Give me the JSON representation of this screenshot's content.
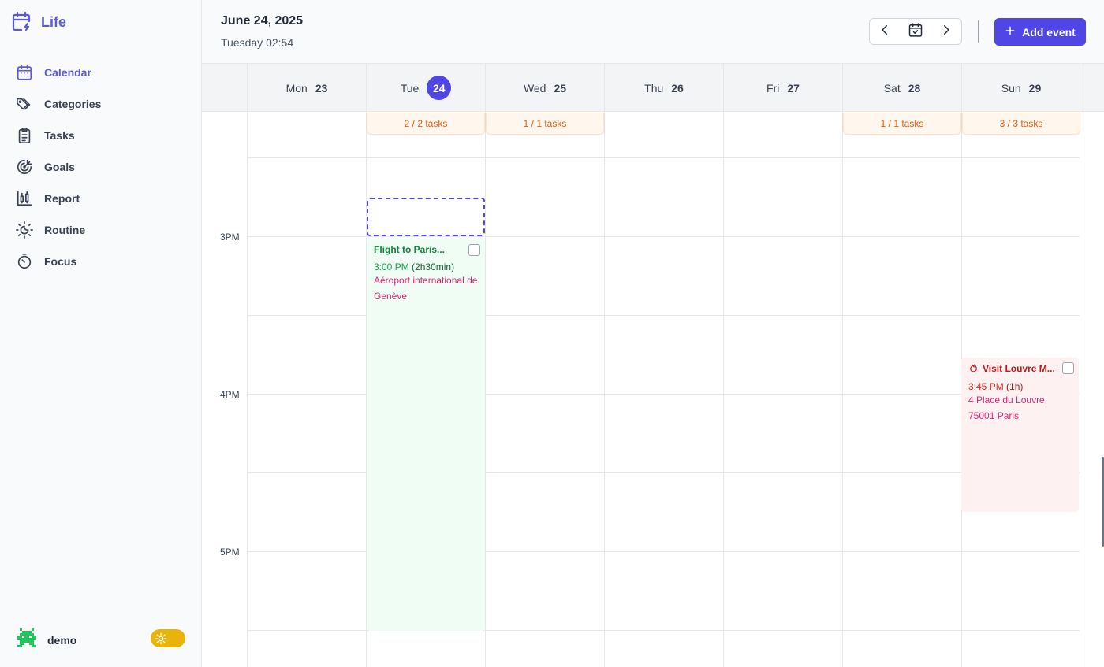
{
  "app": {
    "name": "Life"
  },
  "sidebar": {
    "items": [
      {
        "label": "Calendar",
        "icon": "calendar-icon",
        "active": true
      },
      {
        "label": "Categories",
        "icon": "tags-icon"
      },
      {
        "label": "Tasks",
        "icon": "clipboard-icon"
      },
      {
        "label": "Goals",
        "icon": "target-icon"
      },
      {
        "label": "Report",
        "icon": "report-icon"
      },
      {
        "label": "Routine",
        "icon": "sun-moon-icon"
      },
      {
        "label": "Focus",
        "icon": "timer-icon"
      }
    ],
    "user": {
      "name": "demo"
    },
    "theme": "light"
  },
  "header": {
    "date": "June 24, 2025",
    "subtitle": "Tuesday 02:54",
    "add_event_label": "Add event"
  },
  "calendar": {
    "days": [
      {
        "name": "Mon",
        "num": "23",
        "today": false
      },
      {
        "name": "Tue",
        "num": "24",
        "today": true
      },
      {
        "name": "Wed",
        "num": "25",
        "today": false
      },
      {
        "name": "Thu",
        "num": "26",
        "today": false
      },
      {
        "name": "Fri",
        "num": "27",
        "today": false
      },
      {
        "name": "Sat",
        "num": "28",
        "today": false
      },
      {
        "name": "Sun",
        "num": "29",
        "today": false
      }
    ],
    "hours": [
      "3PM",
      "4PM",
      "5PM"
    ],
    "task_badges": [
      {
        "day": "Tue",
        "text": "2 / 2 tasks"
      },
      {
        "day": "Wed",
        "text": "1 / 1 tasks"
      },
      {
        "day": "Sat",
        "text": "1 / 1 tasks"
      },
      {
        "day": "Sun",
        "text": "3 / 3 tasks"
      }
    ],
    "events": [
      {
        "day": "Tue",
        "title": "Flight to Paris...",
        "time": "3:00 PM",
        "duration": "(2h30min)",
        "location": "Aéroport international de Genève",
        "color": "#16a34a"
      },
      {
        "day": "Sun",
        "title": "Visit Louvre M...",
        "time": "3:45 PM",
        "duration": "(1h)",
        "location": "4 Place du Louvre, 75001 Paris",
        "icon": "flame-icon",
        "color": "#dc2626"
      }
    ]
  },
  "colors": {
    "accent": "#4f46e5",
    "brand": "#5b5bd6",
    "badge": "#ea580c",
    "toggle": "#eab308"
  }
}
